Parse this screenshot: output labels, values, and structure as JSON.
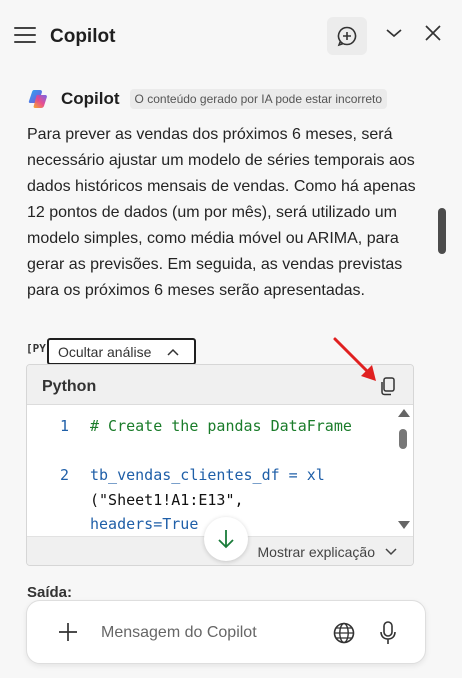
{
  "header": {
    "title": "Copilot"
  },
  "message": {
    "author": "Copilot",
    "disclaimer": "O conteúdo gerado por IA pode estar incorreto",
    "text": "Para prever as vendas dos próximos 6 meses, será necessário ajustar um modelo de séries temporais aos dados históricos mensais de vendas. Como há apenas 12 pontos de dados (um por mês), será utilizado um modelo simples, como média móvel ou ARIMA, para gerar as previsões. Em seguida, as vendas previstas para os próximos 6 meses serão apresentadas."
  },
  "analysis": {
    "badge": "[PY]",
    "toggle_label": "Ocultar análise"
  },
  "code": {
    "language": "Python",
    "lines": [
      {
        "number": "1",
        "comment": "# Create the pandas DataFrame"
      },
      {
        "number": "2",
        "var": "tb_vendas_clientes_df",
        "op": " = xl",
        "args": "(\"Sheet1!A1:E13\",",
        "partial": "headers=True"
      }
    ],
    "explain_label": "Mostrar explicação"
  },
  "output": {
    "label": "Saída:"
  },
  "composer": {
    "placeholder": "Mensagem do Copilot"
  },
  "colors": {
    "accent": "#1f5fa8",
    "annotation": "#e02020"
  },
  "icons": {
    "menu": "hamburger-icon",
    "new_chat": "new-chat-icon",
    "collapse": "chevron-down-icon",
    "close": "close-icon",
    "copy": "copy-icon",
    "scroll_down": "arrow-down-icon",
    "add": "plus-icon",
    "web": "globe-icon",
    "voice": "microphone-icon"
  }
}
